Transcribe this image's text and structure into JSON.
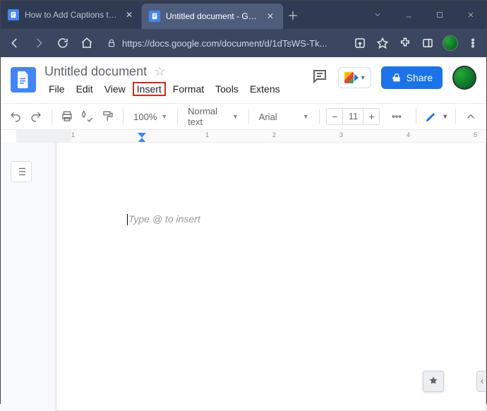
{
  "browser": {
    "tabs": [
      {
        "title": "How to Add Captions to Im",
        "active": false
      },
      {
        "title": "Untitled document - Googl",
        "active": true
      }
    ],
    "url": "https://docs.google.com/document/d/1dTsWS-Tk..."
  },
  "doc": {
    "title": "Untitled document",
    "menu": {
      "file": "File",
      "edit": "Edit",
      "view": "View",
      "insert": "Insert",
      "format": "Format",
      "tools": "Tools",
      "extensions": "Extens"
    },
    "share_label": "Share"
  },
  "toolbar": {
    "zoom": "100%",
    "style": "Normal text",
    "font": "Arial",
    "font_size": "11"
  },
  "page": {
    "placeholder": "Type @ to insert"
  },
  "ruler": {
    "labels": [
      "1",
      "1",
      "2",
      "3",
      "4",
      "5"
    ]
  }
}
